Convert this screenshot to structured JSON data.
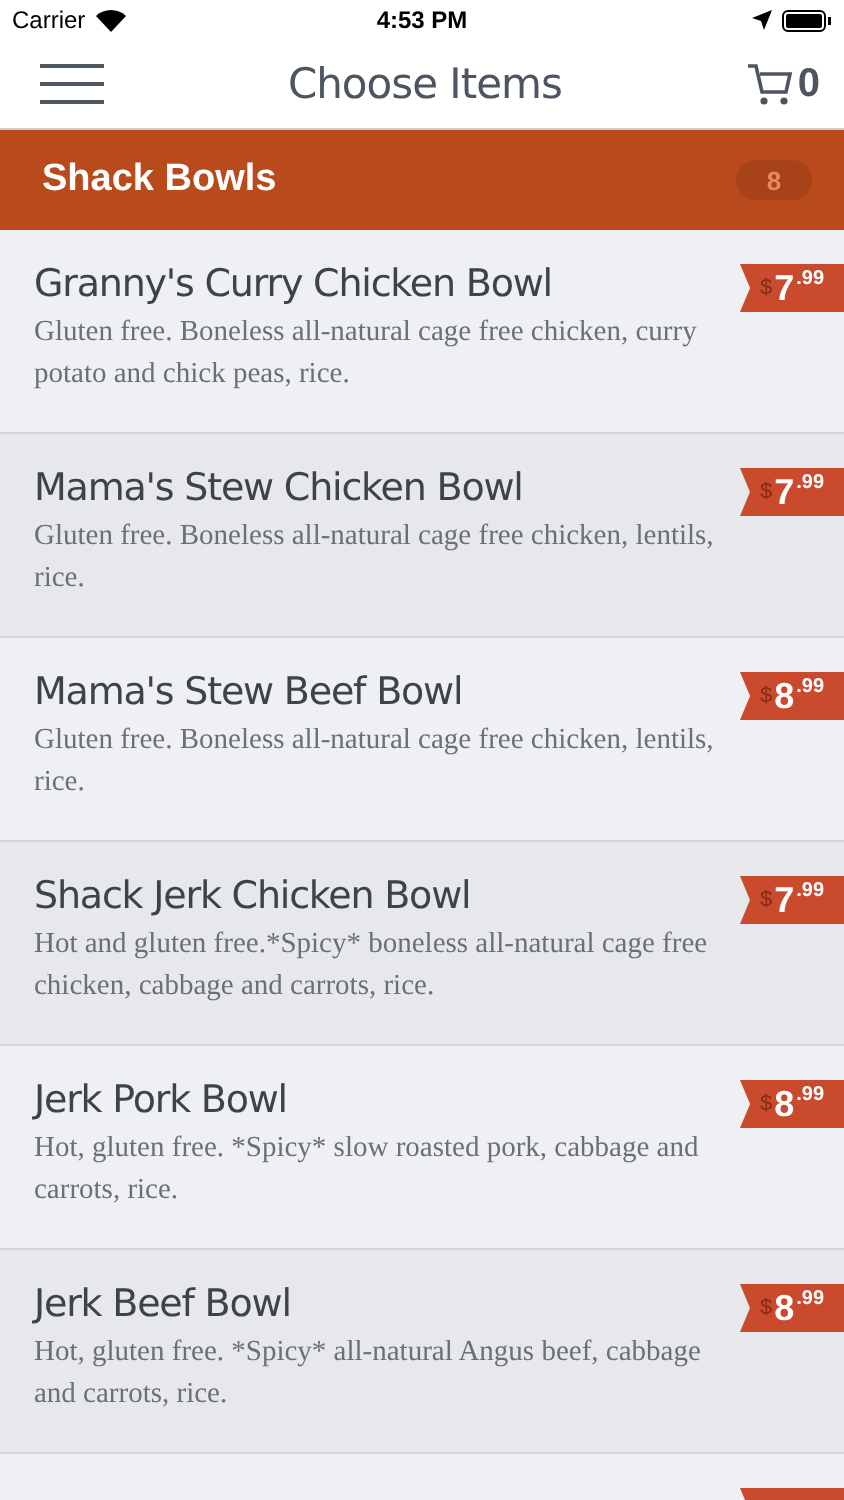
{
  "status_bar": {
    "carrier": "Carrier",
    "time": "4:53 PM"
  },
  "nav": {
    "title": "Choose Items",
    "cart_count": "0"
  },
  "section": {
    "title": "Shack Bowls",
    "count": "8"
  },
  "items": [
    {
      "name": "Granny's Curry Chicken Bowl",
      "description": "Gluten free. Boneless all-natural cage free chicken, curry potato and chick peas, rice.",
      "currency": "$",
      "dollars": "7",
      "cents": ".99"
    },
    {
      "name": "Mama's Stew Chicken Bowl",
      "description": "Gluten free. Boneless all-natural cage free chicken, lentils, rice.",
      "currency": "$",
      "dollars": "7",
      "cents": ".99"
    },
    {
      "name": "Mama's Stew Beef Bowl",
      "description": "Gluten free. Boneless all-natural cage free chicken, lentils, rice.",
      "currency": "$",
      "dollars": "8",
      "cents": ".99"
    },
    {
      "name": "Shack Jerk Chicken Bowl",
      "description": "Hot and gluten free.*Spicy* boneless all-natural cage free chicken, cabbage and carrots, rice.",
      "currency": "$",
      "dollars": "7",
      "cents": ".99"
    },
    {
      "name": "Jerk Pork Bowl",
      "description": "Hot, gluten free. *Spicy* slow roasted pork, cabbage and carrots, rice.",
      "currency": "$",
      "dollars": "8",
      "cents": ".99"
    },
    {
      "name": "Jerk Beef Bowl",
      "description": "Hot, gluten free. *Spicy* all-natural Angus beef, cabbage and carrots, rice.",
      "currency": "$",
      "dollars": "8",
      "cents": ".99"
    }
  ]
}
